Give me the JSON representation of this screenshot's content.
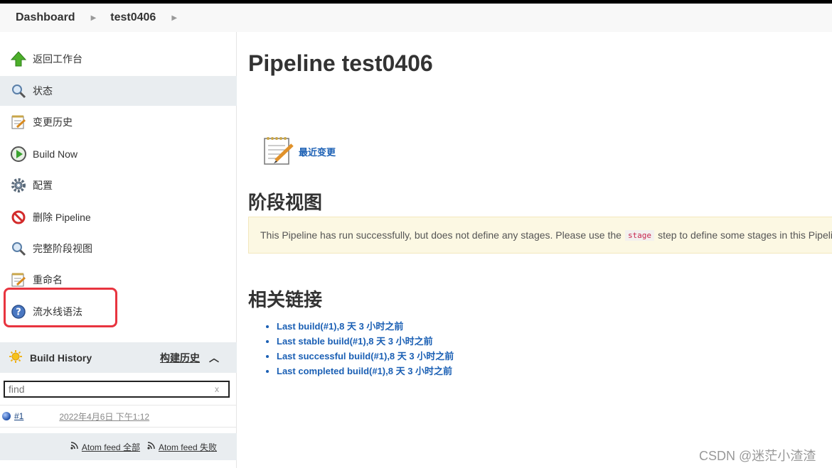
{
  "breadcrumb": {
    "items": [
      "Dashboard",
      "test0406"
    ]
  },
  "sidebar": {
    "tasks": [
      {
        "label": "返回工作台",
        "icon": "up-arrow-icon"
      },
      {
        "label": "状态",
        "icon": "magnifier-icon",
        "active": true
      },
      {
        "label": "变更历史",
        "icon": "notepad-icon"
      },
      {
        "label": "Build Now",
        "icon": "clock-play-icon"
      },
      {
        "label": "配置",
        "icon": "gear-icon"
      },
      {
        "label": "删除 Pipeline",
        "icon": "no-entry-icon"
      },
      {
        "label": "完整阶段视图",
        "icon": "magnifier-icon"
      },
      {
        "label": "重命名",
        "icon": "notepad-icon"
      },
      {
        "label": "流水线语法",
        "icon": "help-icon",
        "highlighted": true
      }
    ],
    "build_history": {
      "title": "Build History",
      "trend_label": "构建历史",
      "search_placeholder": "find",
      "search_clear": "x",
      "builds": [
        {
          "number": "#1",
          "date": "2022年4月6日 下午1:12",
          "status_color": "#1f4fa8"
        }
      ],
      "feeds": {
        "all": "Atom feed 全部",
        "failed": "Atom feed 失败"
      }
    }
  },
  "main": {
    "title": "Pipeline test0406",
    "recent_changes": "最近变更",
    "stage_view_heading": "阶段视图",
    "notice": {
      "before": "This Pipeline has run successfully, but does not define any stages. Please use the",
      "code": "stage",
      "after": "step to define some stages in this Pipeline."
    },
    "related_links_heading": "相关链接",
    "links": [
      "Last build(#1),8 天 3 小时之前",
      "Last stable build(#1),8 天 3 小时之前",
      "Last successful build(#1),8 天 3 小时之前",
      "Last completed build(#1),8 天 3 小时之前"
    ]
  },
  "watermark": "CSDN @迷茫小渣渣",
  "colors": {
    "link": "#1a5fb4",
    "highlight_border": "#e8343f",
    "notice_bg": "#fcf8e3"
  }
}
